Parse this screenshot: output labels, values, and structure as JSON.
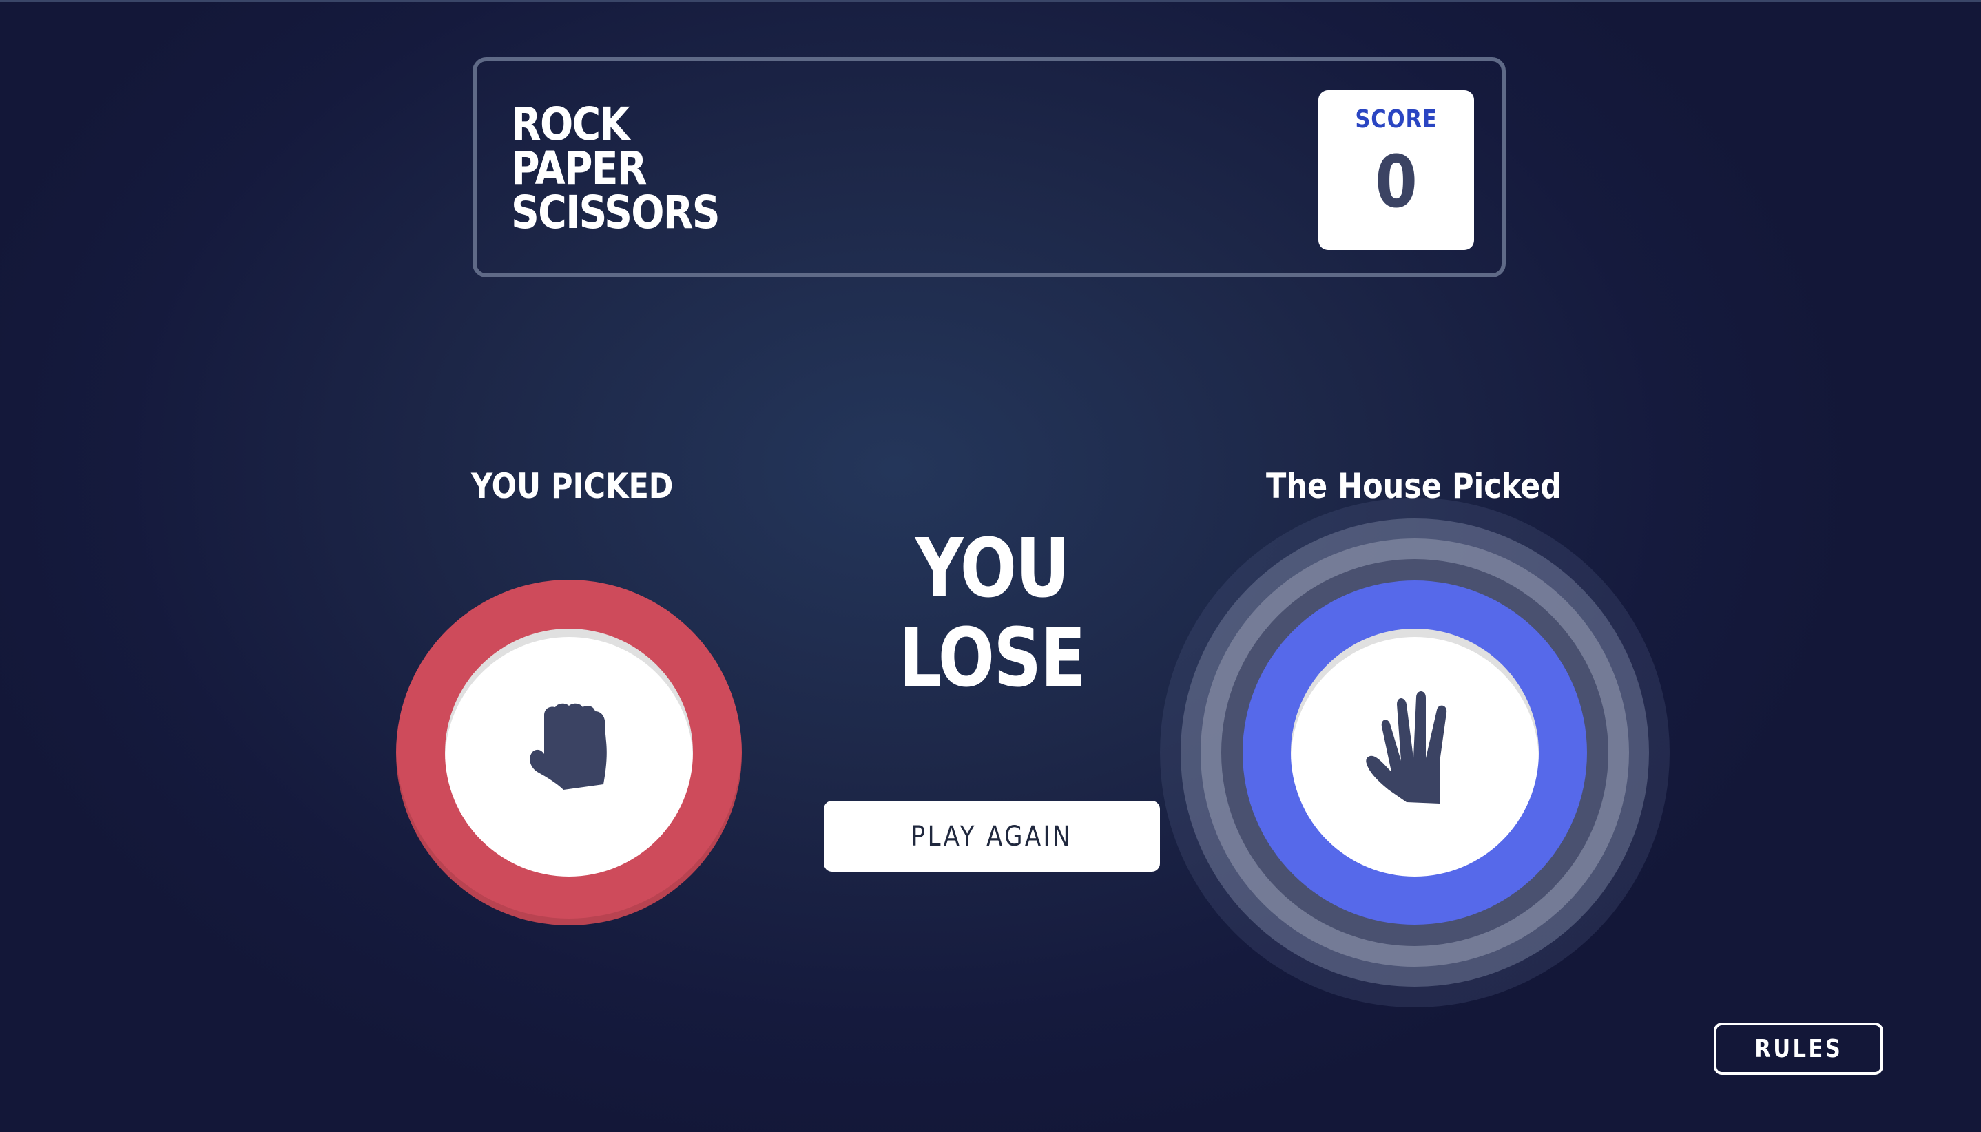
{
  "header": {
    "title_lines": [
      "ROCK",
      "PAPER",
      "SCISSORS"
    ],
    "score_label": "SCORE",
    "score_value": "0"
  },
  "player": {
    "label": "YOU PICKED",
    "choice": "rock",
    "icon": "rock-fist-icon",
    "ring_color": "#ce4b5b"
  },
  "house": {
    "label": "The House Picked",
    "choice": "paper",
    "icon": "paper-hand-icon",
    "ring_color": "#5669ea",
    "winner_highlight": true
  },
  "result": {
    "text": "YOU LOSE",
    "play_again_label": "PLAY AGAIN"
  },
  "footer": {
    "rules_label": "RULES"
  },
  "colors": {
    "background": "#1d2748",
    "header_border": "#5f6a87",
    "score_label": "#2a45c2",
    "score_value": "#3b4363",
    "icon_fill": "#3b4363"
  }
}
